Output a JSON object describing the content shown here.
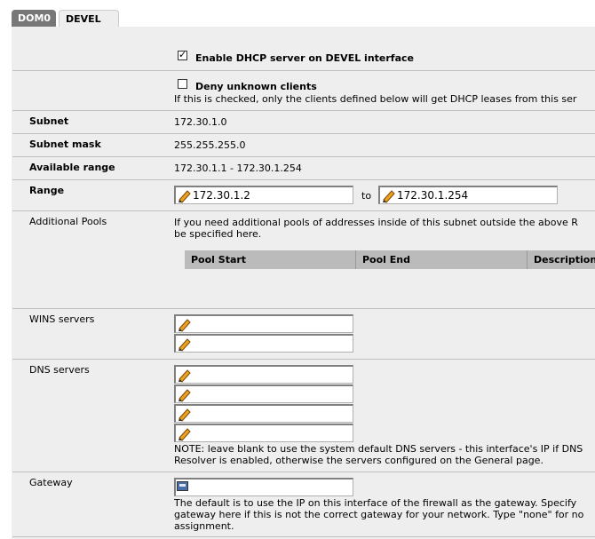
{
  "tabs": [
    {
      "label": "DOM0"
    },
    {
      "label": "DEVEL"
    }
  ],
  "enable": {
    "label": "Enable DHCP server on DEVEL interface",
    "checked": true
  },
  "deny": {
    "label": "Deny unknown clients",
    "checked": false,
    "help": "If this is checked, only the clients defined below will get DHCP leases from this ser"
  },
  "subnet": {
    "label": "Subnet",
    "value": "172.30.1.0"
  },
  "mask": {
    "label": "Subnet mask",
    "value": "255.255.255.0"
  },
  "avail": {
    "label": "Available range",
    "value": "172.30.1.1 - 172.30.1.254"
  },
  "range": {
    "label": "Range",
    "from": "172.30.1.2",
    "to_label": "to",
    "to": "172.30.1.254"
  },
  "pools": {
    "label": "Additional Pools",
    "help1": "If you need additional pools of addresses inside of this subnet outside the above R",
    "help2": "be specified here.",
    "cols": [
      "Pool Start",
      "Pool End",
      "Description"
    ]
  },
  "wins": {
    "label": "WINS servers",
    "values": [
      "",
      ""
    ]
  },
  "dns": {
    "label": "DNS servers",
    "values": [
      "",
      "",
      "",
      ""
    ],
    "note1": "NOTE: leave blank to use the system default DNS servers - this interface's IP if DNS",
    "note2": "Resolver is enabled, otherwise the servers configured on the General page."
  },
  "gateway": {
    "label": "Gateway",
    "value": "",
    "help1": "The default is to use the IP on this interface of the firewall as the gateway. Specify",
    "help2": "gateway here if this is not the correct gateway for your network. Type \"none\" for no",
    "help3": "assignment."
  }
}
